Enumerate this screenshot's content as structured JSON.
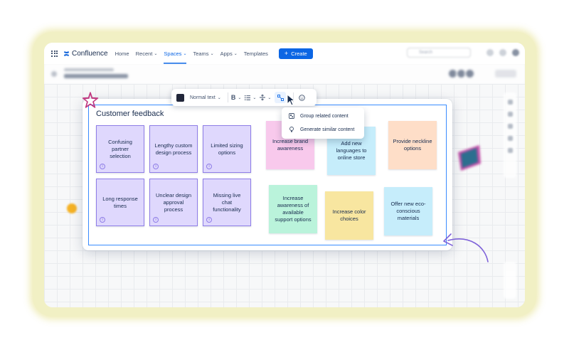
{
  "app": {
    "logo_text": "Confluence",
    "nav": [
      {
        "label": "Home",
        "chevron": false
      },
      {
        "label": "Recent",
        "chevron": true
      },
      {
        "label": "Spaces",
        "chevron": true,
        "active": true
      },
      {
        "label": "Teams",
        "chevron": true
      },
      {
        "label": "Apps",
        "chevron": true
      },
      {
        "label": "Templates",
        "chevron": false
      }
    ],
    "create_label": "Create",
    "search_placeholder": "Search"
  },
  "whiteboard": {
    "title": "Customer feedback",
    "toolbar": {
      "text_style": "Normal text",
      "bold_label": "B"
    },
    "ai_menu": {
      "items": [
        {
          "label": "Group related content",
          "icon": "group-icon"
        },
        {
          "label": "Generate similar content",
          "icon": "lightbulb-icon"
        }
      ]
    },
    "purple_stickies": [
      "Confusing partner selection",
      "Lengthy custom design process",
      "Limited sizing options",
      "Long response times",
      "Unclear design approval process",
      "Missing live chat functionality"
    ],
    "color_stickies": [
      {
        "text": "Increase brand awareness",
        "color": "#f8c9ec"
      },
      {
        "text": "Add new languages to online store",
        "color": "#c6edfb"
      },
      {
        "text": "Provide neckline options",
        "color": "#fedec8"
      },
      {
        "text": "Increase awareness of available support options",
        "color": "#baf3db"
      },
      {
        "text": "Increase color choices",
        "color": "#f8e6a0"
      },
      {
        "text": "Offer new eco-conscious materials",
        "color": "#c6edfb"
      }
    ]
  },
  "colors": {
    "accent": "#0c66e4",
    "selection": "#388bff",
    "purple_border": "#8f7ee7",
    "purple_fill": "#dfd8fd"
  }
}
